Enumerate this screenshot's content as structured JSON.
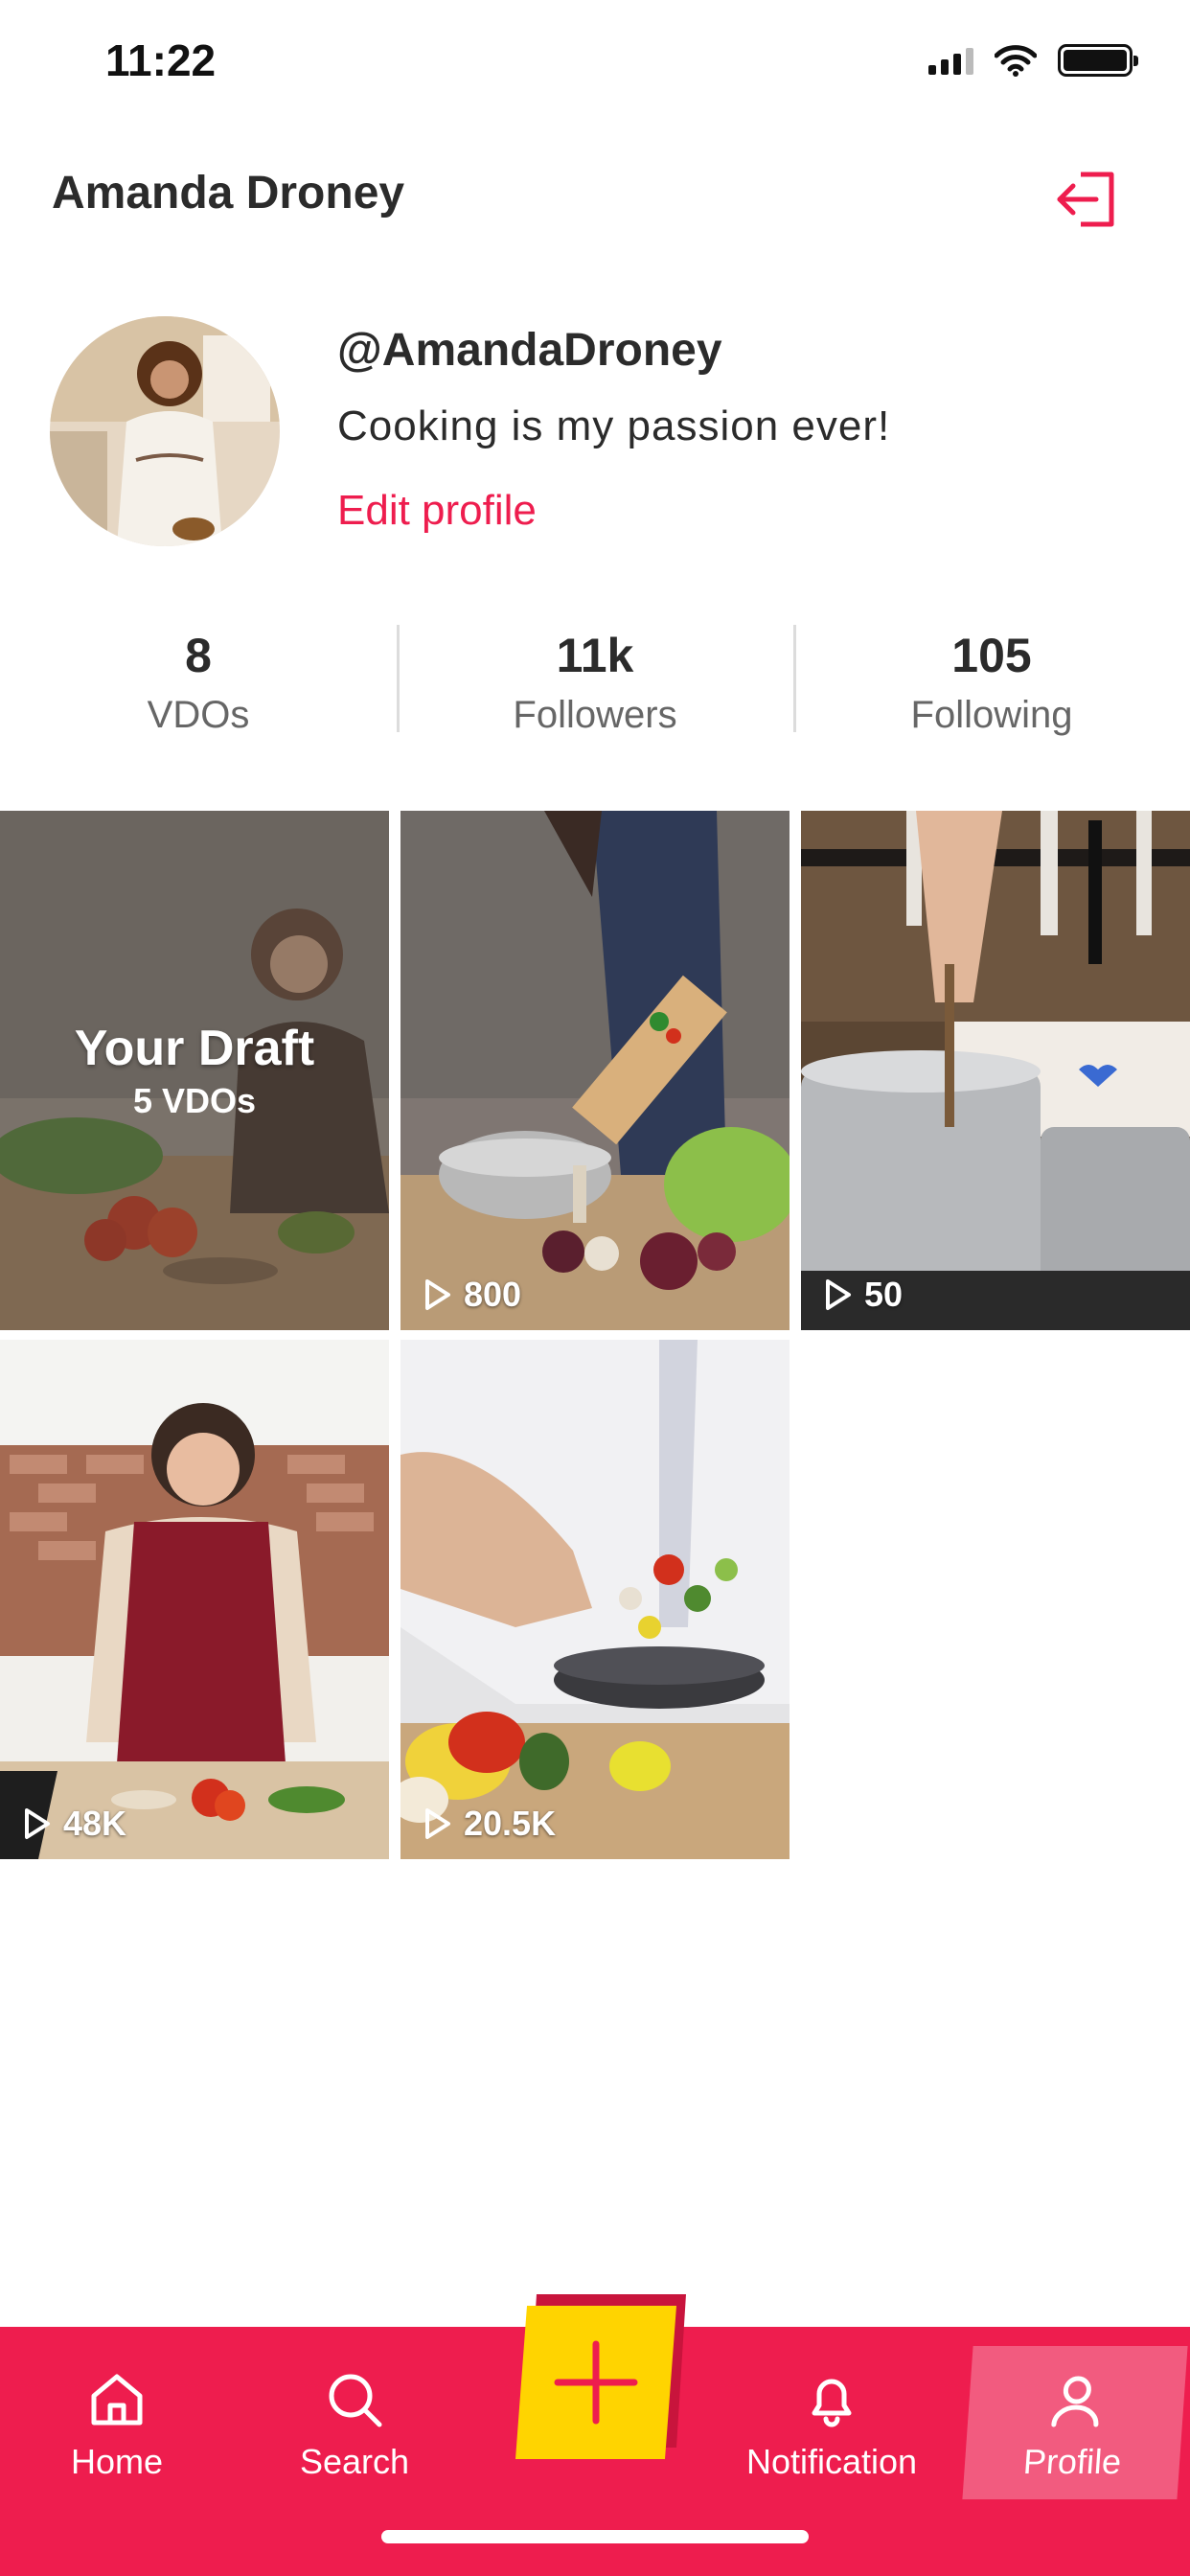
{
  "status_bar": {
    "time": "11:22"
  },
  "header": {
    "name": "Amanda Droney"
  },
  "profile": {
    "handle": "@AmandaDroney",
    "bio": "Cooking is my passion ever!",
    "edit_label": "Edit profile"
  },
  "stats": [
    {
      "value": "8",
      "label": "VDOs"
    },
    {
      "value": "11k",
      "label": "Followers"
    },
    {
      "value": "105",
      "label": "Following"
    }
  ],
  "draft": {
    "title": "Your Draft",
    "count": "5 VDOs"
  },
  "videos": [
    {
      "views": "800"
    },
    {
      "views": "50"
    },
    {
      "views": "48K"
    },
    {
      "views": "20.5K"
    }
  ],
  "nav": {
    "home": "Home",
    "search": "Search",
    "notification": "Notification",
    "profile": "Profile"
  },
  "colors": {
    "accent": "#ee1d4e",
    "add_button": "#ffd400"
  }
}
